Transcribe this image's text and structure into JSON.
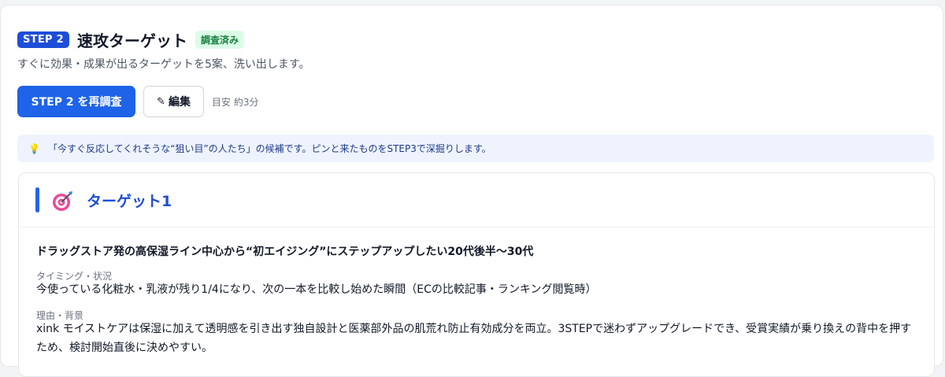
{
  "step": {
    "badge": "STEP 2",
    "title": "速攻ターゲット",
    "status": "調査済み",
    "description": "すぐに効果・成果が出るターゲットを5案、洗い出します。"
  },
  "actions": {
    "rerun_label": "STEP 2 を再調査",
    "edit_label": "編集",
    "estimate": "目安 約3分"
  },
  "tip": {
    "text": "「今すぐ反応してくれそうな“狙い目”の人たち」の候補です。ピンと来たものをSTEP3で深掘りします。"
  },
  "target_card": {
    "title": "ターゲット1",
    "name": "ドラッグストア発の高保湿ライン中心から“初エイジング”にステップアップしたい20代後半〜30代",
    "timing_label": "タイミング・状況",
    "timing_value": "今使っている化粧水・乳液が残り1/4になり、次の一本を比較し始めた瞬間（ECの比較記事・ランキング閲覧時）",
    "reason_label": "理由・背景",
    "reason_value": "xink モイストケアは保湿に加えて透明感を引き出す独自設計と医薬部外品の肌荒れ防止有効成分を両立。3STEPで迷わずアップグレードでき、受賞実績が乗り換えの背中を押すため、検討開始直後に決めやすい。"
  },
  "icons": {
    "edit": "pencil-icon",
    "tip": "lightbulb-icon",
    "target": "target-dart-icon"
  },
  "colors": {
    "primary": "#1e63e8",
    "badge": "#1d4ed8",
    "status_bg": "#dcfce7",
    "status_text": "#15803d",
    "tip_bg": "#eef3fd"
  }
}
